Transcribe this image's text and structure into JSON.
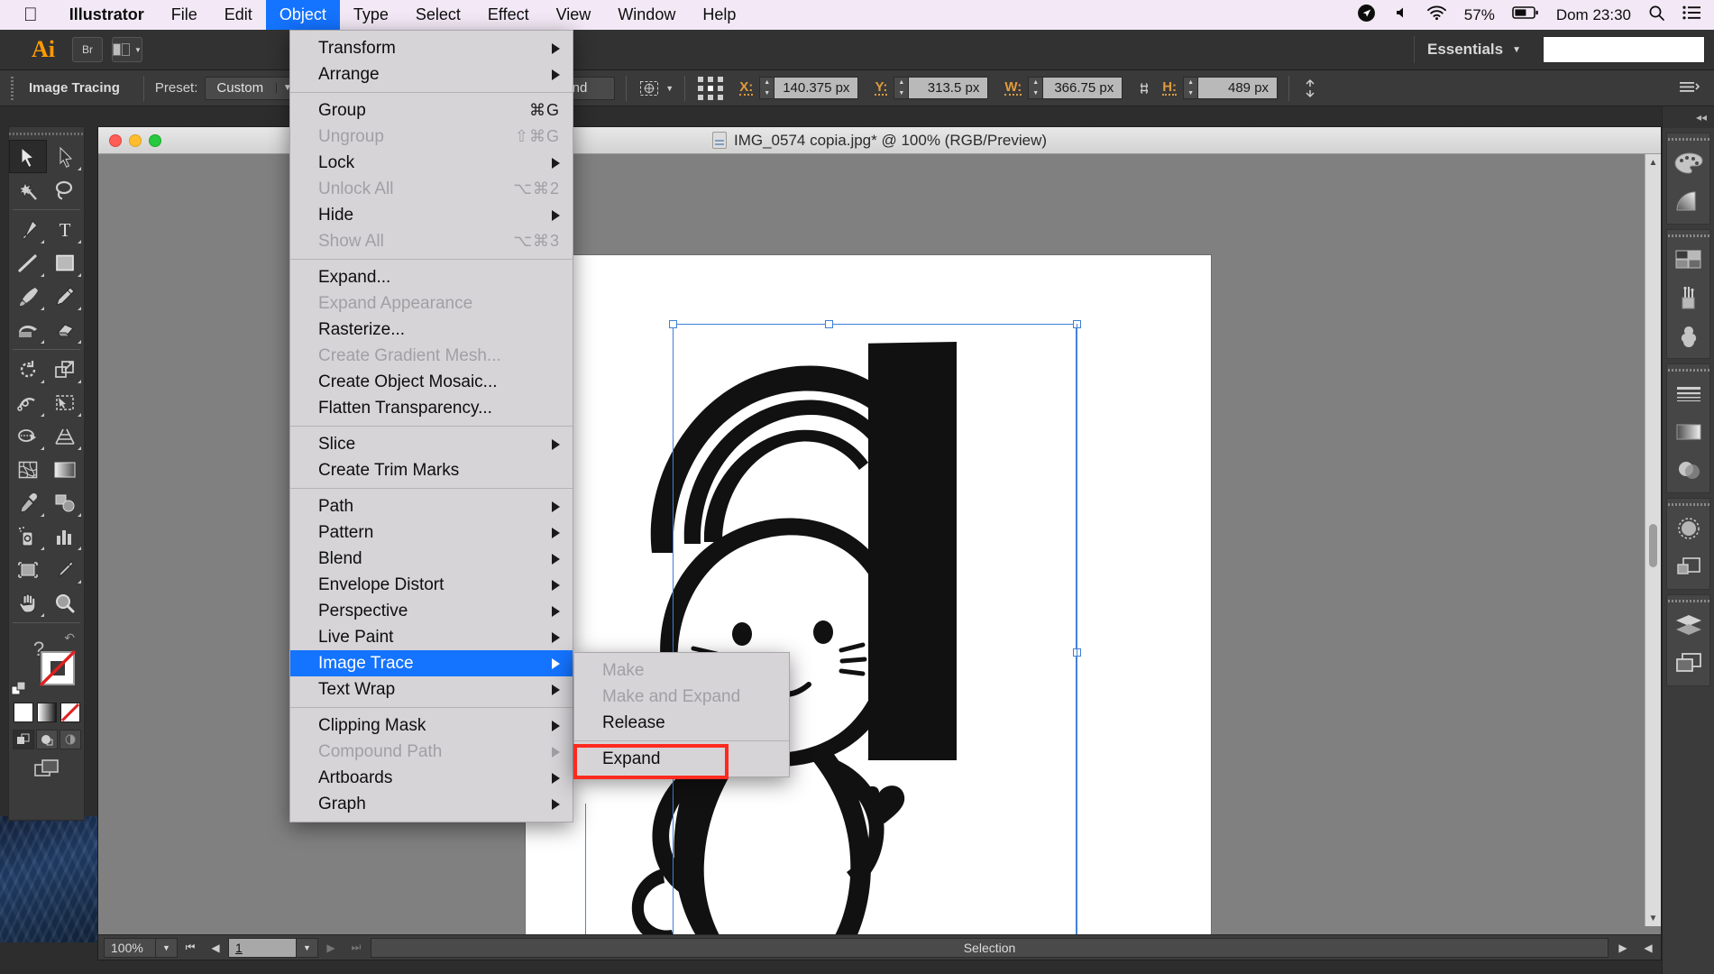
{
  "macmenu": {
    "apple_icon": "apple-icon",
    "app_name": "Illustrator",
    "items": [
      "File",
      "Edit",
      "Object",
      "Type",
      "Select",
      "Effect",
      "View",
      "Window",
      "Help"
    ],
    "active_item": "Object",
    "status": {
      "location_icon": "location-arrow-icon",
      "volume_icon": "volume-icon",
      "wifi_icon": "wifi-icon",
      "battery_percent": "57%",
      "battery_icon": "battery-icon",
      "clock": "Dom 23:30",
      "search_icon": "spotlight-search-icon",
      "notifications_icon": "notification-center-icon"
    }
  },
  "appbar": {
    "logo": "Ai",
    "bridge_label": "Br",
    "arrange_icon": "arrange-documents-icon",
    "workspace": "Essentials",
    "workspace_caret": "chevron-down-icon",
    "search_value": "",
    "search_placeholder": ""
  },
  "controlbar": {
    "panel_title": "Image Tracing",
    "preset_label": "Preset:",
    "preset_value": "Custom",
    "view_value": "",
    "expand_button": "Expand",
    "transform_icon": "transform-icon",
    "reference_point_icon": "reference-point-icon",
    "fields": [
      {
        "label": "X:",
        "value": "140.375 px"
      },
      {
        "label": "Y:",
        "value": "313.5 px"
      },
      {
        "label": "W:",
        "value": "366.75 px"
      },
      {
        "label": "H:",
        "value": "489 px"
      }
    ],
    "link_icon": "constrain-proportions-icon",
    "align_icon": "align-icon",
    "more_icon": "more-options-icon"
  },
  "tools": {
    "rows": [
      [
        {
          "icon": "selection-tool-icon",
          "selected": true
        },
        {
          "icon": "direct-selection-tool-icon",
          "selected": false
        }
      ],
      [
        {
          "icon": "magic-wand-tool-icon",
          "selected": false
        },
        {
          "icon": "lasso-tool-icon",
          "selected": false
        }
      ],
      [
        {
          "icon": "pen-tool-icon",
          "selected": false
        },
        {
          "icon": "type-tool-icon",
          "selected": false
        }
      ],
      [
        {
          "icon": "line-segment-tool-icon",
          "selected": false
        },
        {
          "icon": "rectangle-tool-icon",
          "selected": false
        }
      ],
      [
        {
          "icon": "paintbrush-tool-icon",
          "selected": false
        },
        {
          "icon": "pencil-tool-icon",
          "selected": false
        }
      ],
      [
        {
          "icon": "blob-brush-tool-icon",
          "selected": false
        },
        {
          "icon": "eraser-tool-icon",
          "selected": false
        }
      ],
      [
        {
          "icon": "rotate-tool-icon",
          "selected": false
        },
        {
          "icon": "scale-tool-icon",
          "selected": false
        }
      ],
      [
        {
          "icon": "width-tool-icon",
          "selected": false
        },
        {
          "icon": "free-transform-tool-icon",
          "selected": false
        }
      ],
      [
        {
          "icon": "shape-builder-tool-icon",
          "selected": false
        },
        {
          "icon": "perspective-grid-tool-icon",
          "selected": false
        }
      ],
      [
        {
          "icon": "mesh-tool-icon",
          "selected": false
        },
        {
          "icon": "gradient-tool-icon",
          "selected": false
        }
      ],
      [
        {
          "icon": "eyedropper-tool-icon",
          "selected": false
        },
        {
          "icon": "blend-tool-icon",
          "selected": false
        }
      ],
      [
        {
          "icon": "symbol-sprayer-tool-icon",
          "selected": false
        },
        {
          "icon": "column-graph-tool-icon",
          "selected": false
        }
      ],
      [
        {
          "icon": "artboard-tool-icon",
          "selected": false
        },
        {
          "icon": "slice-tool-icon",
          "selected": false
        }
      ],
      [
        {
          "icon": "hand-tool-icon",
          "selected": false
        },
        {
          "icon": "zoom-tool-icon",
          "selected": false
        }
      ]
    ],
    "fill_label": "fill-swatch",
    "stroke_label": "stroke-swatch",
    "none_label": "none-swatch",
    "question_mark": "?",
    "swap_icon": "swap-fill-stroke-icon",
    "default_icon": "default-fill-stroke-icon",
    "color_modes": [
      "color-swatch",
      "gradient-swatch",
      "none-swatch"
    ],
    "draw_modes": [
      "draw-normal-icon",
      "draw-behind-icon",
      "draw-inside-icon"
    ],
    "screen_mode": "change-screen-mode-icon"
  },
  "document": {
    "title": "IMG_0574 copia.jpg* @ 100% (RGB/Preview)",
    "file_icon": "document-icon",
    "window_buttons": [
      "close-button",
      "minimize-button",
      "zoom-button"
    ]
  },
  "statusbar": {
    "zoom": "100%",
    "zoom_caret": "chevron-down-icon",
    "first_icon": "first-artboard-icon",
    "prev_icon": "previous-artboard-icon",
    "page": "1",
    "page_caret": "chevron-down-icon",
    "next_icon": "next-artboard-icon",
    "last_icon": "last-artboard-icon",
    "status_text": "Selection",
    "overflow_icon": "status-menu-icon",
    "scroll_left_icon": "scroll-left-icon"
  },
  "object_menu": {
    "sections": [
      [
        {
          "label": "Transform",
          "shortcut": "",
          "submenu": true,
          "disabled": false,
          "highlighted": false
        },
        {
          "label": "Arrange",
          "shortcut": "",
          "submenu": true,
          "disabled": false,
          "highlighted": false
        }
      ],
      [
        {
          "label": "Group",
          "shortcut": "⌘G",
          "submenu": false,
          "disabled": false,
          "highlighted": false
        },
        {
          "label": "Ungroup",
          "shortcut": "⇧⌘G",
          "submenu": false,
          "disabled": true,
          "highlighted": false
        },
        {
          "label": "Lock",
          "shortcut": "",
          "submenu": true,
          "disabled": false,
          "highlighted": false
        },
        {
          "label": "Unlock All",
          "shortcut": "⌥⌘2",
          "submenu": false,
          "disabled": true,
          "highlighted": false
        },
        {
          "label": "Hide",
          "shortcut": "",
          "submenu": true,
          "disabled": false,
          "highlighted": false
        },
        {
          "label": "Show All",
          "shortcut": "⌥⌘3",
          "submenu": false,
          "disabled": true,
          "highlighted": false
        }
      ],
      [
        {
          "label": "Expand...",
          "shortcut": "",
          "submenu": false,
          "disabled": false,
          "highlighted": false
        },
        {
          "label": "Expand Appearance",
          "shortcut": "",
          "submenu": false,
          "disabled": true,
          "highlighted": false
        },
        {
          "label": "Rasterize...",
          "shortcut": "",
          "submenu": false,
          "disabled": false,
          "highlighted": false
        },
        {
          "label": "Create Gradient Mesh...",
          "shortcut": "",
          "submenu": false,
          "disabled": true,
          "highlighted": false
        },
        {
          "label": "Create Object Mosaic...",
          "shortcut": "",
          "submenu": false,
          "disabled": false,
          "highlighted": false
        },
        {
          "label": "Flatten Transparency...",
          "shortcut": "",
          "submenu": false,
          "disabled": false,
          "highlighted": false
        }
      ],
      [
        {
          "label": "Slice",
          "shortcut": "",
          "submenu": true,
          "disabled": false,
          "highlighted": false
        },
        {
          "label": "Create Trim Marks",
          "shortcut": "",
          "submenu": false,
          "disabled": false,
          "highlighted": false
        }
      ],
      [
        {
          "label": "Path",
          "shortcut": "",
          "submenu": true,
          "disabled": false,
          "highlighted": false
        },
        {
          "label": "Pattern",
          "shortcut": "",
          "submenu": true,
          "disabled": false,
          "highlighted": false
        },
        {
          "label": "Blend",
          "shortcut": "",
          "submenu": true,
          "disabled": false,
          "highlighted": false
        },
        {
          "label": "Envelope Distort",
          "shortcut": "",
          "submenu": true,
          "disabled": false,
          "highlighted": false
        },
        {
          "label": "Perspective",
          "shortcut": "",
          "submenu": true,
          "disabled": false,
          "highlighted": false
        },
        {
          "label": "Live Paint",
          "shortcut": "",
          "submenu": true,
          "disabled": false,
          "highlighted": false
        },
        {
          "label": "Image Trace",
          "shortcut": "",
          "submenu": true,
          "disabled": false,
          "highlighted": true
        },
        {
          "label": "Text Wrap",
          "shortcut": "",
          "submenu": true,
          "disabled": false,
          "highlighted": false
        }
      ],
      [
        {
          "label": "Clipping Mask",
          "shortcut": "",
          "submenu": true,
          "disabled": false,
          "highlighted": false
        },
        {
          "label": "Compound Path",
          "shortcut": "",
          "submenu": true,
          "disabled": true,
          "highlighted": false
        },
        {
          "label": "Artboards",
          "shortcut": "",
          "submenu": true,
          "disabled": false,
          "highlighted": false
        },
        {
          "label": "Graph",
          "shortcut": "",
          "submenu": true,
          "disabled": false,
          "highlighted": false
        }
      ]
    ]
  },
  "image_trace_submenu": {
    "sections": [
      [
        {
          "label": "Make",
          "disabled": true,
          "outlined": false
        },
        {
          "label": "Make and Expand",
          "disabled": true,
          "outlined": false
        },
        {
          "label": "Release",
          "disabled": false,
          "outlined": false
        }
      ],
      [
        {
          "label": "Expand",
          "disabled": false,
          "outlined": true
        }
      ]
    ],
    "highlight_color": "#ff2a1f"
  },
  "colors": {
    "menu_highlight": "#1473ff",
    "accent_orange": "#e09b3d",
    "menubar_bg": "#f3e9f6",
    "panel_bg": "#3b3b3b",
    "canvas_bg": "#808080",
    "annotation_red": "#ff2a1f"
  }
}
